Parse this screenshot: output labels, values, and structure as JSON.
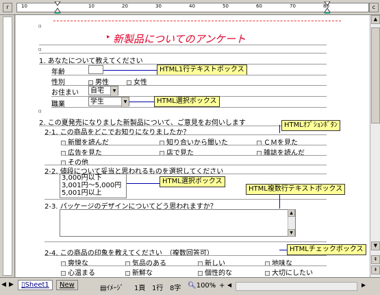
{
  "title": "新製品についてのアンケート",
  "ruler": {
    "top_labels": [
      "10",
      "10",
      "20",
      "30",
      "40",
      "50",
      "60",
      "70",
      "80"
    ],
    "corner_left": "r",
    "corner_right": "c"
  },
  "section1": {
    "heading": "1. あなたについて教えてください",
    "age_label": "年齢",
    "gender_label": "性別",
    "gender_options": [
      "男性",
      "女性"
    ],
    "residence_label": "お住まい",
    "residence_value": "自宅",
    "job_label": "職業",
    "job_value": "学生"
  },
  "section2": {
    "heading": "2. この夏発売になりました新製品について、ご意見をお伺いします",
    "q1": "2-1. この商品をどこでお知りになりましたか？",
    "q1_options": [
      "新聞を読んだ",
      "知り合いから聞いた",
      "ＣＭを見た",
      "広告を見た",
      "店で見た",
      "雑誌を読んだ",
      "その他"
    ],
    "q2": "2-2. 値段について妥当と思われるものを選択してください",
    "q2_options": [
      "3,000円以下",
      "3,001円～5,000円",
      "5,001円以上"
    ],
    "q3": "2-3. パッケージのデザインについてどう思われますか？",
    "q4": "2-4. この商品の印象を教えてください　（複数回答可）",
    "q4_options": [
      "爽快な",
      "気品のある",
      "新しい",
      "地味な",
      "心温まる",
      "新鮮な",
      "個性的な",
      "大切にしたい"
    ]
  },
  "callouts": {
    "textbox": "HTML1行テキストボックス",
    "select1": "HTML選択ボックス",
    "radio": "HTMLｵﾌﾟｼｮﾝﾎﾞﾀﾝ",
    "select2": "HTML選択ボックス",
    "textarea": "HTML複数行テキストボックス",
    "checkbox": "HTMLチェックボックス"
  },
  "statusbar": {
    "sheet1": "Sheet1",
    "new_tab": "New",
    "view": "ｲﾒｰｼﾞ",
    "page": "1頁",
    "line": "1行",
    "col": "8字",
    "zoom": "100%"
  }
}
